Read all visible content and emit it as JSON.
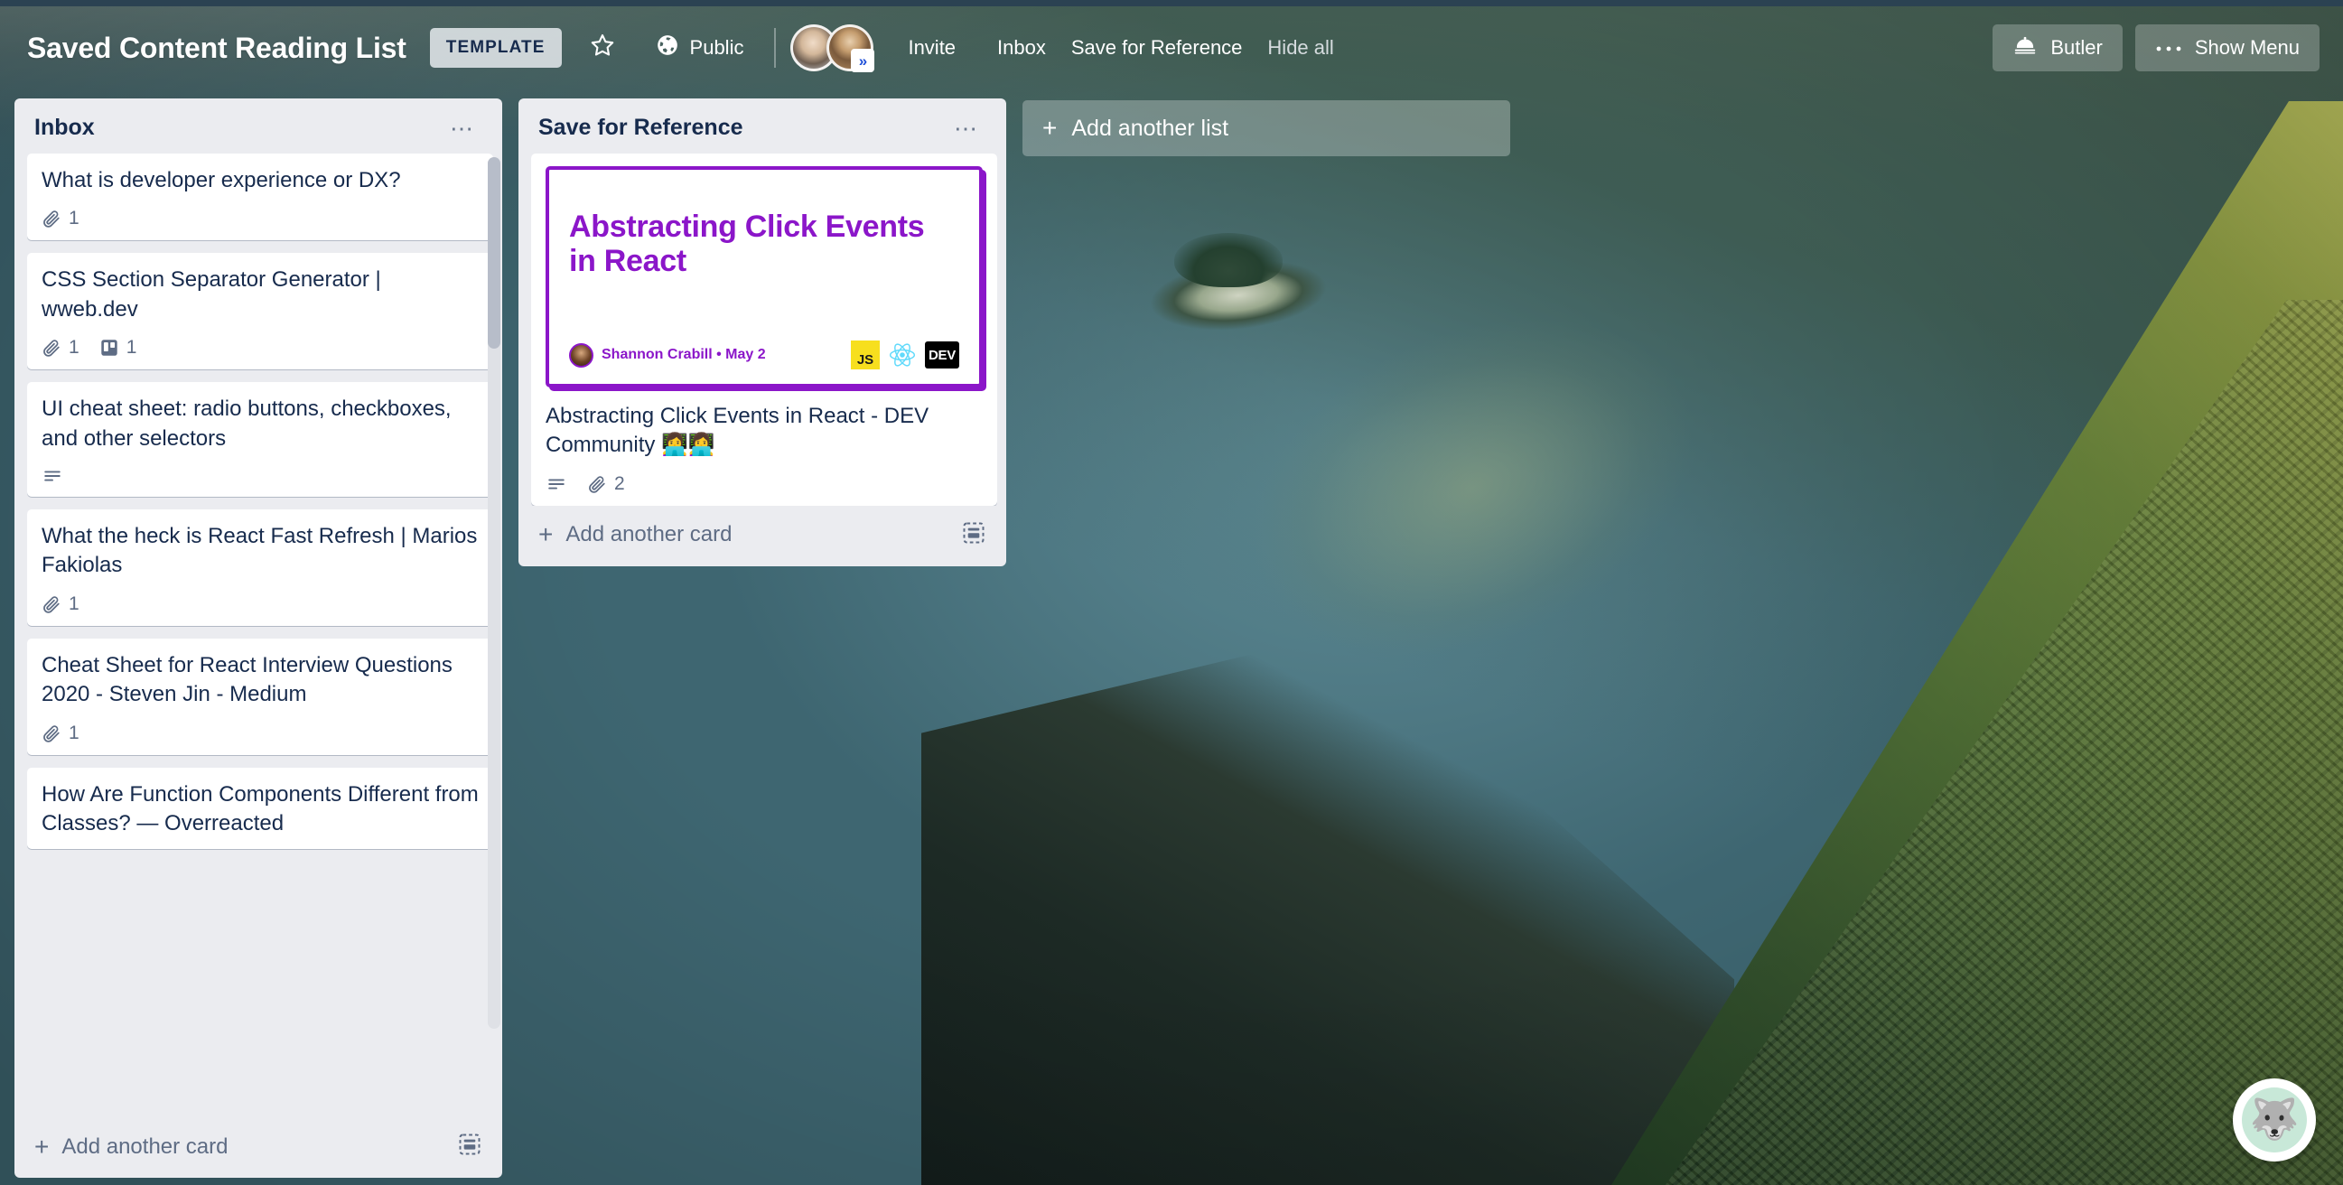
{
  "header": {
    "board_title": "Saved Content Reading List",
    "template_badge": "TEMPLATE",
    "star_icon": "star-outline-icon",
    "visibility_icon": "globe-icon",
    "visibility_label": "Public",
    "invite_label": "Invite",
    "nav_links": [
      {
        "label": "Inbox"
      },
      {
        "label": "Save for Reference"
      },
      {
        "label": "Hide all"
      }
    ],
    "butler_icon": "butler-bell-icon",
    "butler_label": "Butler",
    "show_menu_icon": "ellipsis-icon",
    "show_menu_label": "Show Menu"
  },
  "lists": [
    {
      "title": "Inbox",
      "menu_icon": "ellipsis-icon",
      "add_card_label": "Add another card",
      "card_template_icon": "card-template-icon",
      "cards": [
        {
          "title": "What is developer experience or DX?",
          "badges": [
            {
              "icon": "attachment-icon",
              "count": "1"
            }
          ]
        },
        {
          "title": "CSS Section Separator Generator | wweb.dev",
          "badges": [
            {
              "icon": "attachment-icon",
              "count": "1"
            },
            {
              "icon": "trello-board-icon",
              "count": "1"
            }
          ]
        },
        {
          "title": "UI cheat sheet: radio buttons, checkboxes, and other selectors",
          "badges": [
            {
              "icon": "description-icon",
              "count": ""
            }
          ]
        },
        {
          "title": "What the heck is React Fast Refresh | Marios Fakiolas",
          "badges": [
            {
              "icon": "attachment-icon",
              "count": "1"
            }
          ]
        },
        {
          "title": "Cheat Sheet for React Interview Questions 2020 - Steven Jin - Medium",
          "badges": [
            {
              "icon": "attachment-icon",
              "count": "1"
            }
          ]
        },
        {
          "title": "How Are Function Components Different from Classes? — Overreacted",
          "badges": []
        }
      ]
    },
    {
      "title": "Save for Reference",
      "menu_icon": "ellipsis-icon",
      "add_card_label": "Add another card",
      "card_template_icon": "card-template-icon",
      "cards": [
        {
          "cover": {
            "heading": "Abstracting Click Events in React",
            "author": "Shannon Crabill • May 2",
            "logos": [
              {
                "name": "javascript-logo",
                "text": "JS"
              },
              {
                "name": "react-logo",
                "text": ""
              },
              {
                "name": "dev-logo",
                "text": "DEV"
              }
            ]
          },
          "title": "Abstracting Click Events in React - DEV Community 👩‍💻👩‍💻",
          "badges": [
            {
              "icon": "description-icon",
              "count": ""
            },
            {
              "icon": "attachment-icon",
              "count": "2"
            }
          ]
        }
      ]
    }
  ],
  "add_list": {
    "label": "Add another list",
    "plus_icon": "plus-icon"
  },
  "help_widget": {
    "icon": "husky-dog-avatar",
    "glyph": "🐺"
  },
  "colors": {
    "list_background": "#ebecf0",
    "card_background": "#ffffff",
    "text_primary": "#172b4d",
    "text_muted": "#5e6c84",
    "cover_accent": "#8b16c9",
    "top_strip": "#2b4252"
  }
}
